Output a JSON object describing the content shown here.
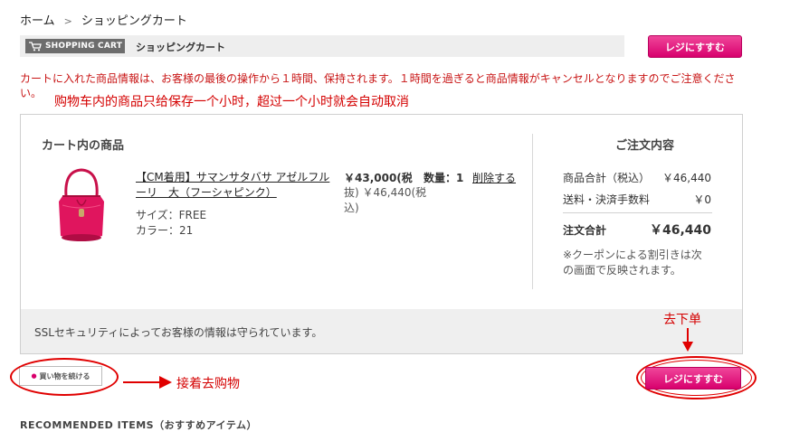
{
  "breadcrumb": {
    "home": "ホーム",
    "separator": ">",
    "current": "ショッピングカート"
  },
  "header": {
    "logo_text": "SHOPPING CART",
    "title": "ショッピングカート",
    "checkout_label": "レジにすすむ"
  },
  "notice": "カートに入れた商品情報は、お客様の最後の操作から１時間、保持されます。１時間を過ぎると商品情報がキャンセルとなりますのでご注意ください。",
  "annotations": {
    "notice_cn": "购物车内的商品只给保存一个小时，超过一个小时就会自动取消",
    "checkout_cn": "去下单",
    "continue_cn": "接着去购物"
  },
  "cart": {
    "heading": "カート内の商品",
    "item": {
      "name": "【CM着用】サマンサタバサ アゼルフルーリ　大（フーシャピンク）",
      "size": "サイズ：FREE",
      "color": "カラー：21",
      "price_excl": "￥43,000(税",
      "price_incl": "抜) ￥46,440(税込)",
      "quantity": "数量：1",
      "delete_label": "削除する"
    }
  },
  "summary": {
    "title": "ご注文内容",
    "subtotal_label": "商品合計（税込）",
    "subtotal_value": "￥46,440",
    "shipping_label": "送料・決済手数料",
    "shipping_value": "￥0",
    "total_label": "注文合計",
    "total_value": "￥46,440",
    "coupon_note": "※クーポンによる割引きは次の画面で反映されます。"
  },
  "ssl_text": "SSLセキュリティによってお客様の情報は守られています。",
  "continue_label": "買い物を続ける",
  "checkout_bottom_label": "レジにすすむ",
  "recommend_heading": "RECOMMENDED ITEMS（おすすめアイテム）",
  "colors": {
    "accent_pink": "#d8006d",
    "annotation_red": "#e00000",
    "notice_red": "#c81414"
  }
}
